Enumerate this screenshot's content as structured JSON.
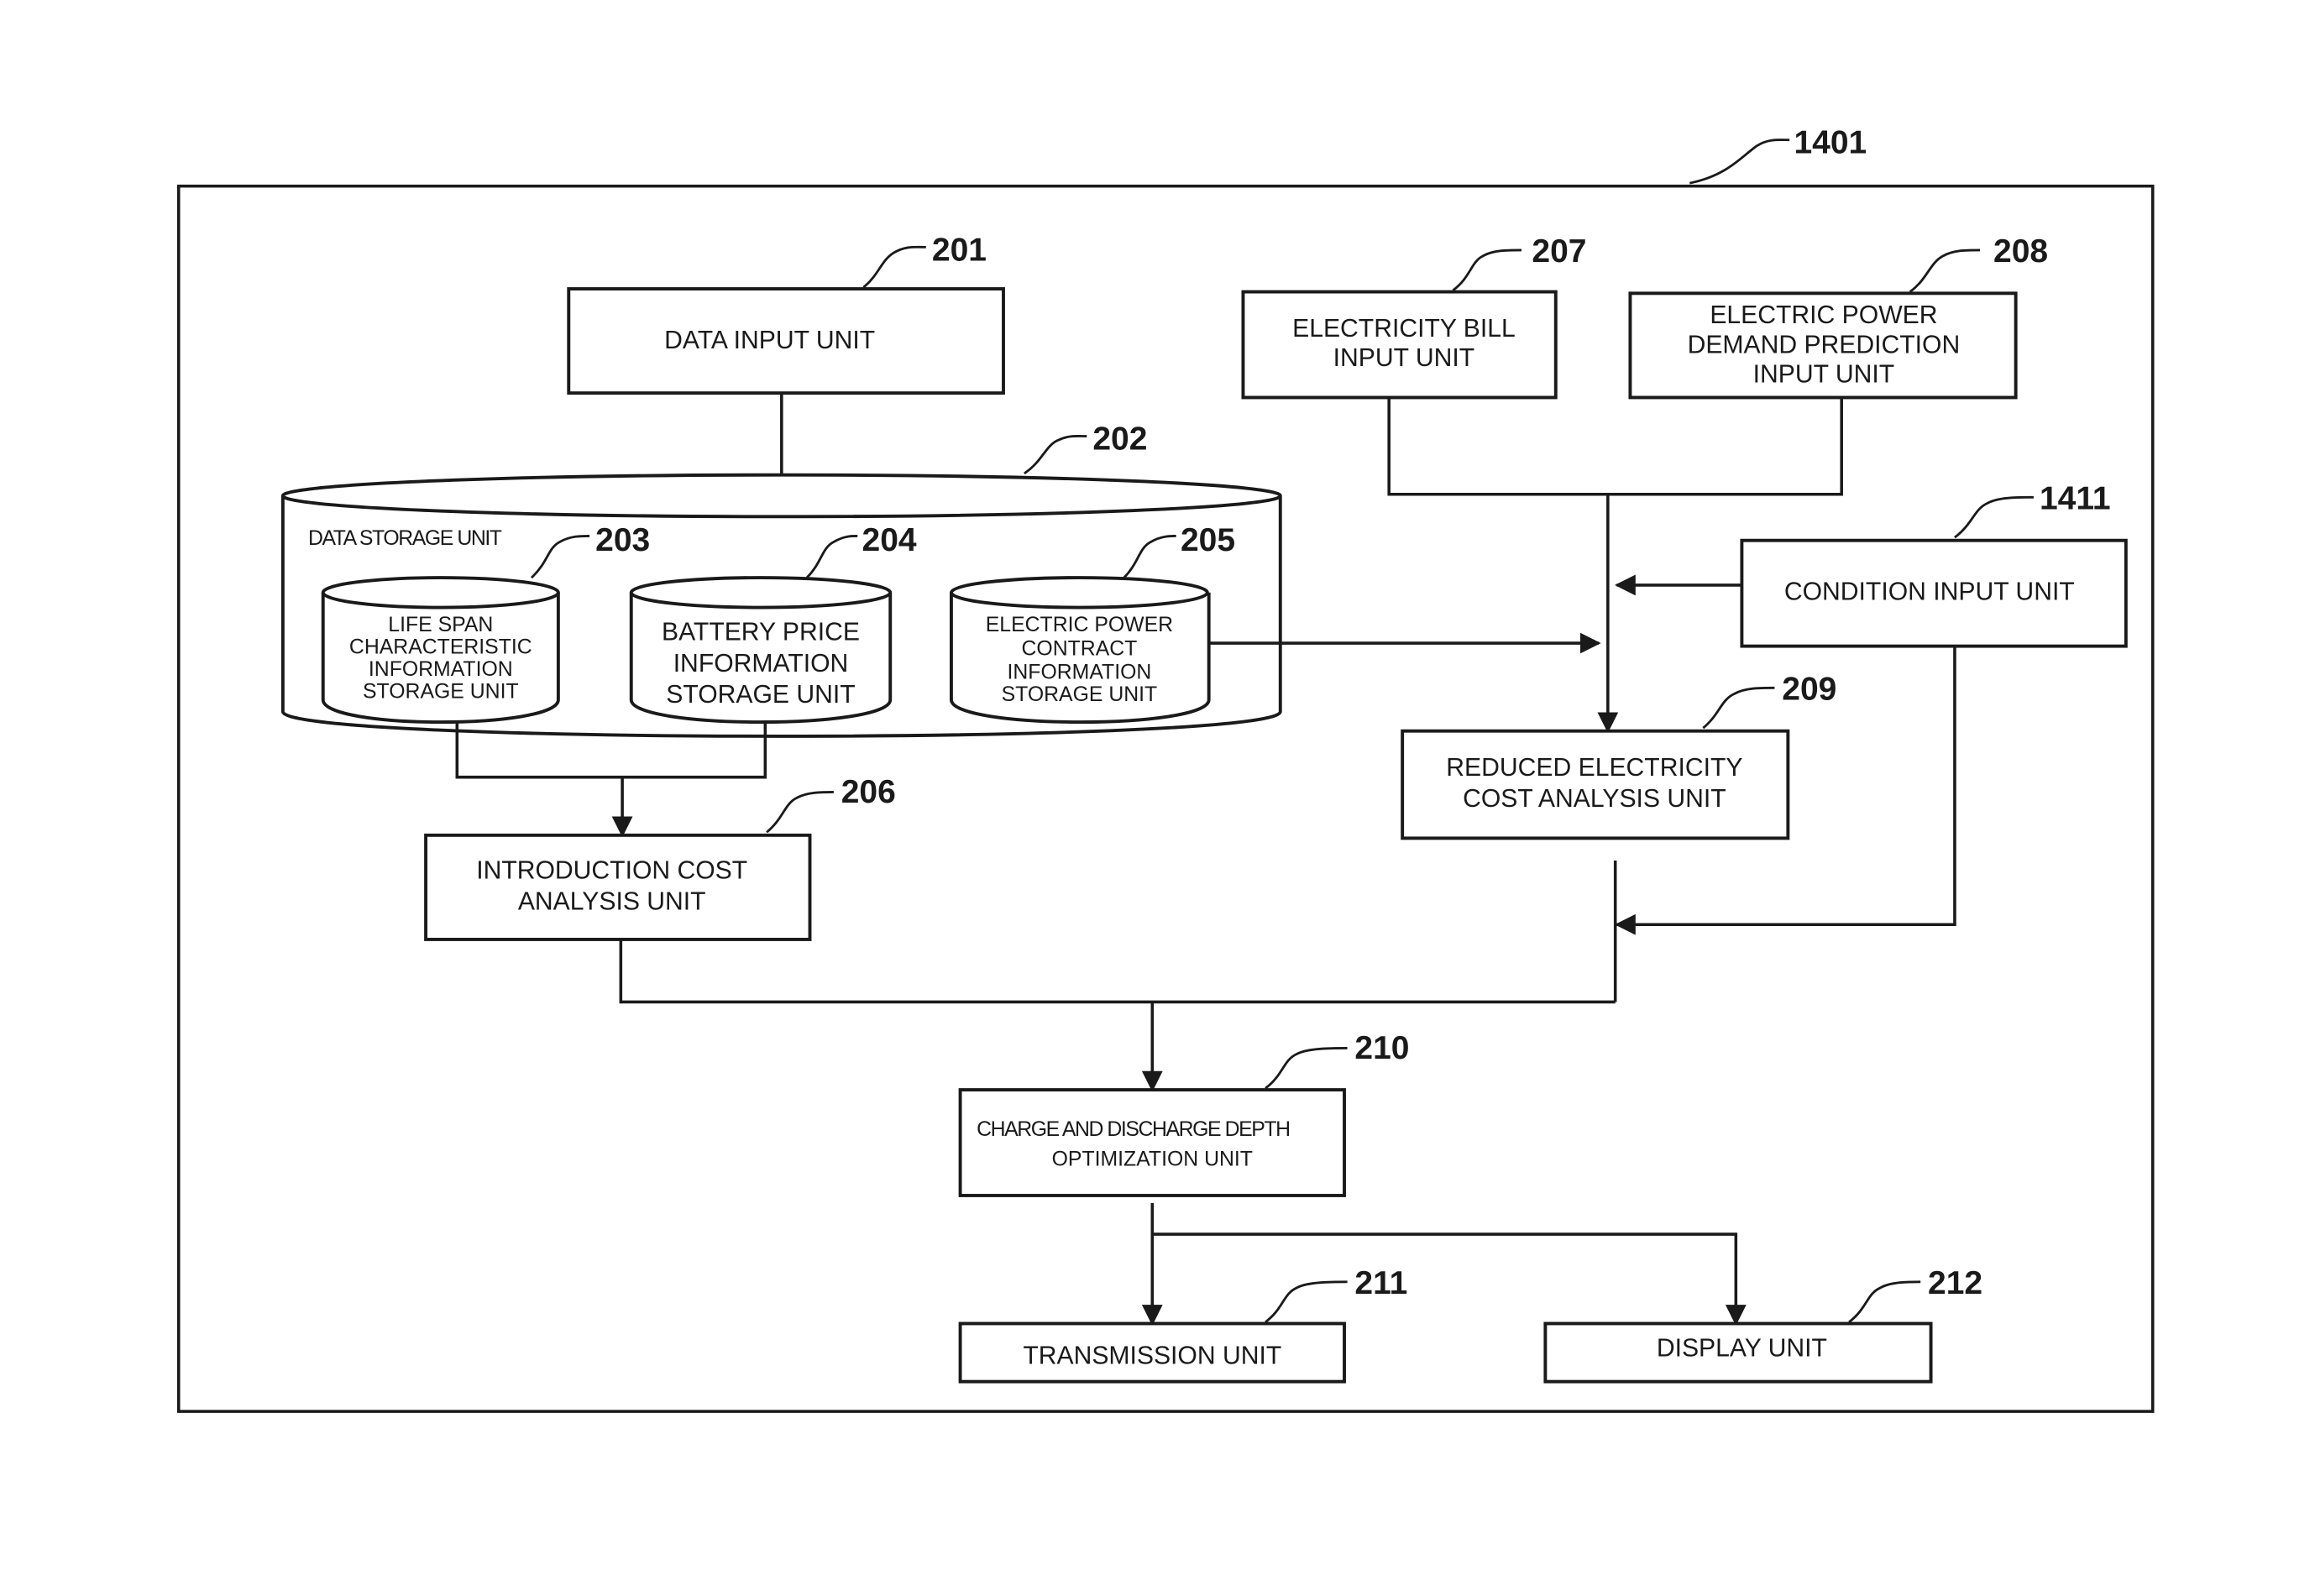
{
  "figure": {
    "system_ref": "1401",
    "blocks": {
      "data_input": {
        "ref": "201",
        "lines": [
          "DATA INPUT UNIT"
        ]
      },
      "data_storage": {
        "ref": "202",
        "lines": [
          "DATA STORAGE UNIT"
        ]
      },
      "life_span": {
        "ref": "203",
        "lines": [
          "LIFE SPAN",
          "CHARACTERISTIC",
          "INFORMATION",
          "STORAGE UNIT"
        ]
      },
      "battery_price": {
        "ref": "204",
        "lines": [
          "BATTERY PRICE",
          "INFORMATION",
          "STORAGE UNIT"
        ]
      },
      "contract_info": {
        "ref": "205",
        "lines": [
          "ELECTRIC POWER",
          "CONTRACT",
          "INFORMATION",
          "STORAGE UNIT"
        ]
      },
      "introduction_cost": {
        "ref": "206",
        "lines": [
          "INTRODUCTION COST",
          "ANALYSIS UNIT"
        ]
      },
      "electricity_bill": {
        "ref": "207",
        "lines": [
          "ELECTRICITY BILL",
          "INPUT UNIT"
        ]
      },
      "demand_prediction": {
        "ref": "208",
        "lines": [
          "ELECTRIC POWER",
          "DEMAND PREDICTION",
          "INPUT UNIT"
        ]
      },
      "reduced_cost": {
        "ref": "209",
        "lines": [
          "REDUCED ELECTRICITY",
          "COST ANALYSIS UNIT"
        ]
      },
      "optimization": {
        "ref": "210",
        "lines": [
          "CHARGE AND DISCHARGE DEPTH",
          "OPTIMIZATION UNIT"
        ]
      },
      "transmission": {
        "ref": "211",
        "lines": [
          "TRANSMISSION UNIT"
        ]
      },
      "display": {
        "ref": "212",
        "lines": [
          "DISPLAY UNIT"
        ]
      },
      "condition_input": {
        "ref": "1411",
        "lines": [
          "CONDITION INPUT UNIT"
        ]
      }
    }
  }
}
